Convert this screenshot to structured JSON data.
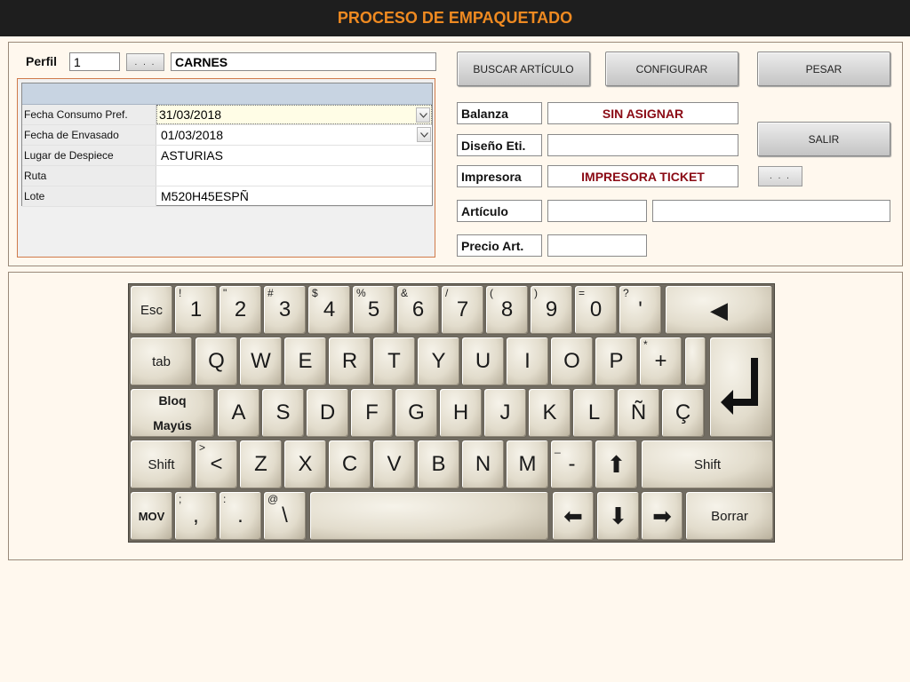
{
  "window": {
    "title": "PROCESO DE EMPAQUETADO"
  },
  "profile": {
    "label": "Perfil",
    "number": "1",
    "browse_label": ". . .",
    "name": "CARNES"
  },
  "grid": {
    "rows": [
      {
        "label": "Fecha Consumo Pref.",
        "value": "31/03/2018",
        "dropdown": true,
        "selected": true
      },
      {
        "label": "Fecha de Envasado",
        "value": "01/03/2018",
        "dropdown": true,
        "selected": false
      },
      {
        "label": "Lugar de Despiece",
        "value": "ASTURIAS",
        "dropdown": false,
        "selected": false
      },
      {
        "label": "Ruta",
        "value": "",
        "dropdown": false,
        "selected": false
      },
      {
        "label": "Lote",
        "value": "M520H45ESPÑ",
        "dropdown": false,
        "selected": false
      }
    ]
  },
  "buttons": {
    "buscar": "BUSCAR ARTÍCULO",
    "configurar": "CONFIGURAR",
    "pesar": "PESAR",
    "salir": "SALIR",
    "printer_browse": ". . ."
  },
  "info": {
    "balanza_label": "Balanza",
    "balanza_value": "SIN ASIGNAR",
    "diseno_label": "Diseño Eti.",
    "diseno_value": "",
    "impresora_label": "Impresora",
    "impresora_value": "IMPRESORA TICKET",
    "articulo_label": "Artículo",
    "articulo_code": "",
    "articulo_name": "",
    "precio_label": "Precio Art.",
    "precio_value": ""
  },
  "keyboard": {
    "row1": [
      {
        "label": "Esc",
        "sub": "",
        "name": "key-esc",
        "cls": "small"
      },
      {
        "label": "1",
        "sub": "!",
        "name": "key-1"
      },
      {
        "label": "2",
        "sub": "\"",
        "name": "key-2"
      },
      {
        "label": "3",
        "sub": "#",
        "name": "key-3"
      },
      {
        "label": "4",
        "sub": "$",
        "name": "key-4"
      },
      {
        "label": "5",
        "sub": "%",
        "name": "key-5"
      },
      {
        "label": "6",
        "sub": "&",
        "name": "key-6"
      },
      {
        "label": "7",
        "sub": "/",
        "name": "key-7"
      },
      {
        "label": "8",
        "sub": "(",
        "name": "key-8"
      },
      {
        "label": "9",
        "sub": ")",
        "name": "key-9"
      },
      {
        "label": "0",
        "sub": "=",
        "name": "key-0"
      },
      {
        "label": "'",
        "sub": "?",
        "name": "key-apostrophe"
      },
      {
        "label": "◀",
        "sub": "",
        "name": "backspace-key",
        "cls": "arrow"
      }
    ],
    "row2": [
      {
        "label": "tab",
        "sub": "",
        "name": "key-tab",
        "cls": "small"
      },
      {
        "label": "Q",
        "sub": "",
        "name": "key-q"
      },
      {
        "label": "W",
        "sub": "",
        "name": "key-w"
      },
      {
        "label": "E",
        "sub": "",
        "name": "key-e"
      },
      {
        "label": "R",
        "sub": "",
        "name": "key-r"
      },
      {
        "label": "T",
        "sub": "",
        "name": "key-t"
      },
      {
        "label": "Y",
        "sub": "",
        "name": "key-y"
      },
      {
        "label": "U",
        "sub": "",
        "name": "key-u"
      },
      {
        "label": "I",
        "sub": "",
        "name": "key-i"
      },
      {
        "label": "O",
        "sub": "",
        "name": "key-o"
      },
      {
        "label": "P",
        "sub": "",
        "name": "key-p"
      },
      {
        "label": "+",
        "sub": "*",
        "name": "key-plus"
      }
    ],
    "row3": [
      {
        "label": "Bloq",
        "label2": "Mayús",
        "sub": "",
        "name": "key-caps-lock",
        "cls": "bloq"
      },
      {
        "label": "A",
        "sub": "",
        "name": "key-a"
      },
      {
        "label": "S",
        "sub": "",
        "name": "key-s"
      },
      {
        "label": "D",
        "sub": "",
        "name": "key-d"
      },
      {
        "label": "F",
        "sub": "",
        "name": "key-f"
      },
      {
        "label": "G",
        "sub": "",
        "name": "key-g"
      },
      {
        "label": "H",
        "sub": "",
        "name": "key-h"
      },
      {
        "label": "J",
        "sub": "",
        "name": "key-j"
      },
      {
        "label": "K",
        "sub": "",
        "name": "key-k"
      },
      {
        "label": "L",
        "sub": "",
        "name": "key-l"
      },
      {
        "label": "Ñ",
        "sub": "",
        "name": "key-enye"
      },
      {
        "label": "Ç",
        "sub": "",
        "name": "key-cedilla"
      }
    ],
    "row4": [
      {
        "label": "Shift",
        "sub": "",
        "name": "key-shift-left",
        "cls": "small"
      },
      {
        "label": "<",
        "sub": ">",
        "name": "key-less-than"
      },
      {
        "label": "Z",
        "sub": "",
        "name": "key-z"
      },
      {
        "label": "X",
        "sub": "",
        "name": "key-x"
      },
      {
        "label": "C",
        "sub": "",
        "name": "key-c"
      },
      {
        "label": "V",
        "sub": "",
        "name": "key-v"
      },
      {
        "label": "B",
        "sub": "",
        "name": "key-b"
      },
      {
        "label": "N",
        "sub": "",
        "name": "key-n"
      },
      {
        "label": "M",
        "sub": "",
        "name": "key-m"
      },
      {
        "label": "-",
        "sub": "_",
        "name": "key-minus"
      },
      {
        "label": "⬆",
        "sub": "",
        "name": "arrow-up-key",
        "cls": "arrow"
      },
      {
        "label": "Shift",
        "sub": "",
        "name": "key-shift-right",
        "cls": "small"
      }
    ],
    "row5": [
      {
        "label": "MOV",
        "sub": "",
        "name": "key-mov",
        "cls": "tiny"
      },
      {
        "label": ",",
        "sub": ";",
        "name": "key-comma"
      },
      {
        "label": ".",
        "sub": ":",
        "name": "key-period"
      },
      {
        "label": "\\",
        "sub": "@",
        "name": "key-backslash"
      },
      {
        "label": "",
        "sub": "",
        "name": "space-key"
      },
      {
        "label": "⬅",
        "sub": "",
        "name": "arrow-left-key",
        "cls": "arrow"
      },
      {
        "label": "⬇",
        "sub": "",
        "name": "arrow-down-key",
        "cls": "arrow"
      },
      {
        "label": "➡",
        "sub": "",
        "name": "arrow-right-key",
        "cls": "arrow"
      },
      {
        "label": "Borrar",
        "sub": "",
        "name": "key-borrar",
        "cls": "small"
      }
    ],
    "enter_glyph": "↵"
  }
}
